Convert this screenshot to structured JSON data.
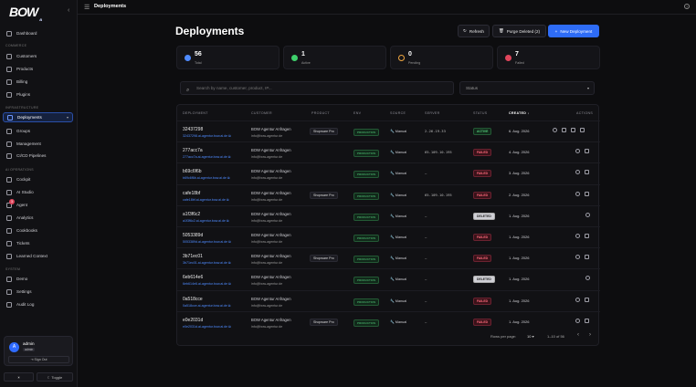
{
  "brand": {
    "name": "BOW",
    "sub": "AI"
  },
  "sidebar": {
    "dashboard": "Dashboard",
    "commerce_section": "COMMERCE",
    "commerce": [
      "Customers",
      "Products",
      "Billing",
      "Plugins"
    ],
    "infra_section": "INFRASTRUCTURE",
    "infra": [
      "Deployments",
      "Groups",
      "Management",
      "CI/CD Pipelines"
    ],
    "ai_section": "AI OPERATIONS",
    "ai": [
      "Cockpit",
      "AI Studio",
      "Agent",
      "Analytics",
      "Cookbooks",
      "Tickets",
      "Learned Context"
    ],
    "agent_badge": "3",
    "system_section": "SYSTEM",
    "system": [
      "Demo",
      "Settings",
      "Audit Log"
    ]
  },
  "user": {
    "initial": "A",
    "name": "admin",
    "role": "admin",
    "signout": "Sign Out"
  },
  "theme": {
    "light_icon": "☀",
    "dark": "Hell",
    "toggle": "Toggle"
  },
  "topbar": {
    "title": "Deployments",
    "help_icon": "?"
  },
  "page": {
    "title": "Deployments"
  },
  "buttons": {
    "refresh": "Refresh",
    "purge": "Purge Deleted (2)",
    "new": "New Deployment"
  },
  "stats": [
    {
      "value": "56",
      "label": "Total",
      "color": "#4f8bff"
    },
    {
      "value": "1",
      "label": "Active",
      "color": "#3ecf6b"
    },
    {
      "value": "0",
      "label": "Pending",
      "color": "#f0a640"
    },
    {
      "value": "7",
      "label": "Failed",
      "color": "#e0455b"
    }
  ],
  "search": {
    "placeholder": "Search by name, customer, product, IP..."
  },
  "status_filter": {
    "label": "Status"
  },
  "table": {
    "headers": [
      "DEPLOYMENT",
      "CUSTOMER",
      "PRODUCT",
      "ENV",
      "SOURCE",
      "SERVER",
      "STATUS",
      "CREATED",
      "ACTIONS"
    ],
    "rows": [
      {
        "id": "32437298",
        "domain": "32437298.ai-agentur.bow.ai.de",
        "customer": "BOW Agentur Anfragen",
        "email": "info@bow-agentur.de",
        "product": "Shopware Pro",
        "env": "PRODUCTION",
        "source": "Manual",
        "server": "2.26.19.33",
        "status": "ACTIVE",
        "status_class": "active",
        "created": "6. Aug. 2026"
      },
      {
        "id": "277acc7a",
        "domain": "277acc7a.ai-agentur.bow.ai.de",
        "customer": "BOW Agentur Anfragen",
        "email": "info@bow-agentur.de",
        "product": "",
        "env": "PRODUCTION",
        "source": "Manual",
        "server": "65.109.10.195",
        "status": "FAILED",
        "status_class": "failed",
        "created": "4. Aug. 2026"
      },
      {
        "id": "b69c6f6b",
        "domain": "b69c6f6b.ai-agentur.bow.ai.de",
        "customer": "BOW Agentur Anfragen",
        "email": "info@bow-agentur.de",
        "product": "",
        "env": "PRODUCTION",
        "source": "Manual",
        "server": "—",
        "status": "FAILED",
        "status_class": "failed",
        "created": "3. Aug. 2026"
      },
      {
        "id": "cafe18bf",
        "domain": "cafe18bf.ai-agentur.bow.ai.de",
        "customer": "BOW Agentur Anfragen",
        "email": "info@bow-agentur.de",
        "product": "Shopware Pro",
        "env": "PRODUCTION",
        "source": "Manual",
        "server": "65.109.10.195",
        "status": "FAILED",
        "status_class": "failed",
        "created": "2. Aug. 2026"
      },
      {
        "id": "a1f3f6c2",
        "domain": "a1f3f6c2.ai-agentur.bow.ai.de",
        "customer": "BOW Agentur Anfragen",
        "email": "info@bow-agentur.de",
        "product": "",
        "env": "PRODUCTION",
        "source": "Manual",
        "server": "—",
        "status": "DELETED",
        "status_class": "deleted",
        "created": "1. Aug. 2026"
      },
      {
        "id": "5053389d",
        "domain": "5053389d.ai-agentur.bow.ai.de",
        "customer": "BOW Agentur Anfragen",
        "email": "info@bow-agentur.de",
        "product": "",
        "env": "PRODUCTION",
        "source": "Manual",
        "server": "—",
        "status": "FAILED",
        "status_class": "failed",
        "created": "1. Aug. 2026"
      },
      {
        "id": "3b71ec01",
        "domain": "3b71ec01.ai-agentur.bow.ai.de",
        "customer": "BOW Agentur Anfragen",
        "email": "info@bow-agentur.de",
        "product": "Shopware Pro",
        "env": "PRODUCTION",
        "source": "Manual",
        "server": "—",
        "status": "FAILED",
        "status_class": "failed",
        "created": "1. Aug. 2026"
      },
      {
        "id": "6eb614e6",
        "domain": "6eb614e6.ai-agentur.bow.ai.de",
        "customer": "BOW Agentur Anfragen",
        "email": "info@bow-agentur.de",
        "product": "",
        "env": "PRODUCTION",
        "source": "Manual",
        "server": "—",
        "status": "DELETED",
        "status_class": "deleted",
        "created": "1. Aug. 2026"
      },
      {
        "id": "0a518cce",
        "domain": "0a518cce.ai-agentur.bow.ai.de",
        "customer": "BOW Agentur Anfragen",
        "email": "info@bow-agentur.de",
        "product": "",
        "env": "PRODUCTION",
        "source": "Manual",
        "server": "—",
        "status": "FAILED",
        "status_class": "failed",
        "created": "1. Aug. 2026"
      },
      {
        "id": "e0e2031d",
        "domain": "e0e2031d.ai-agentur.bow.ai.de",
        "customer": "BOW Agentur Anfragen",
        "email": "info@bow-agentur.de",
        "product": "Shopware Pro",
        "env": "PRODUCTION",
        "source": "Manual",
        "server": "—",
        "status": "FAILED",
        "status_class": "failed",
        "created": "1. Aug. 2026"
      }
    ]
  },
  "pagination": {
    "rows_label": "Rows per page:",
    "rows_value": "10",
    "range": "1–10 of 56",
    "prev": "‹",
    "next": "›"
  }
}
